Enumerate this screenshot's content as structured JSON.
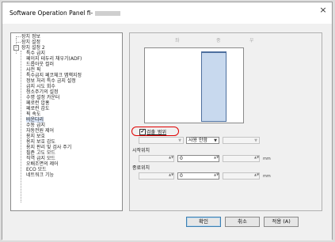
{
  "window": {
    "title": "Software Operation Panel fi-"
  },
  "tree": {
    "items": [
      {
        "label": "장치 정보"
      },
      {
        "label": "장치 설정"
      },
      {
        "label": "장치 설정 2"
      },
      {
        "label": "특수 급지"
      },
      {
        "label": "페이지 테두리 채우기(ADF)"
      },
      {
        "label": "드롭아웃 컬러"
      },
      {
        "label": "사전 픽"
      },
      {
        "label": "특수급지 페코체크 맵핵지정"
      },
      {
        "label": "정보 처리 특수 금지 설정"
      },
      {
        "label": "급지 시도 회수"
      },
      {
        "label": "청소주기의 설정"
      },
      {
        "label": "수명 설정 카운터"
      },
      {
        "label": "페로런 압홍"
      },
      {
        "label": "페로런 감도"
      },
      {
        "label": "픽 속도"
      },
      {
        "label": "바운다리"
      },
      {
        "label": "수동 급지"
      },
      {
        "label": "자동전원 제어"
      },
      {
        "label": "용지 보호"
      },
      {
        "label": "용지 보호 감도"
      },
      {
        "label": "용지 판리 및 검사 주기"
      },
      {
        "label": "필쥰 고도 모드"
      },
      {
        "label": "직역 급지 모드"
      },
      {
        "label": "오배조면의 제어"
      },
      {
        "label": "ECO 모드"
      },
      {
        "label": "네트워크 기능"
      }
    ]
  },
  "settings": {
    "columns": [
      "좌",
      "중",
      "우"
    ],
    "checkbox": {
      "label": "검출_범위",
      "checked": true,
      "mark": "✔"
    },
    "combos": [
      {
        "value": ""
      },
      {
        "value": "사용 안함"
      },
      {
        "value": ""
      }
    ],
    "start_label": "시작위치",
    "end_label": "종료위치",
    "start_fields": [
      {
        "value": ""
      },
      {
        "value": "0"
      },
      {
        "value": ""
      }
    ],
    "end_fields": [
      {
        "value": ""
      },
      {
        "value": "0"
      },
      {
        "value": ""
      }
    ],
    "unit": "mm"
  },
  "buttons": {
    "ok": "확인",
    "cancel": "취소",
    "apply": "적용 (A)"
  },
  "icons": {
    "close": "×",
    "dropdown": "▼",
    "spin": "▲▼"
  }
}
